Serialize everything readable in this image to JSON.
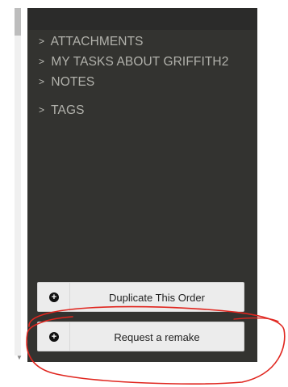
{
  "menu": {
    "items": [
      {
        "label": "ATTACHMENTS",
        "icon": "chevron-right-icon"
      },
      {
        "label": "MY TASKS ABOUT GRIFFITH2",
        "icon": "chevron-right-icon"
      },
      {
        "label": "NOTES",
        "icon": "chevron-right-icon"
      },
      {
        "label": "TAGS",
        "icon": "chevron-right-icon"
      }
    ]
  },
  "actions": {
    "duplicate_label": "Duplicate This Order",
    "remake_label": "Request a remake",
    "icon": "plus-circle-icon"
  },
  "colors": {
    "panel_bg": "#333330",
    "menu_text": "#b2b2ac",
    "button_bg": "#ececec",
    "annotation": "#e0261f"
  }
}
